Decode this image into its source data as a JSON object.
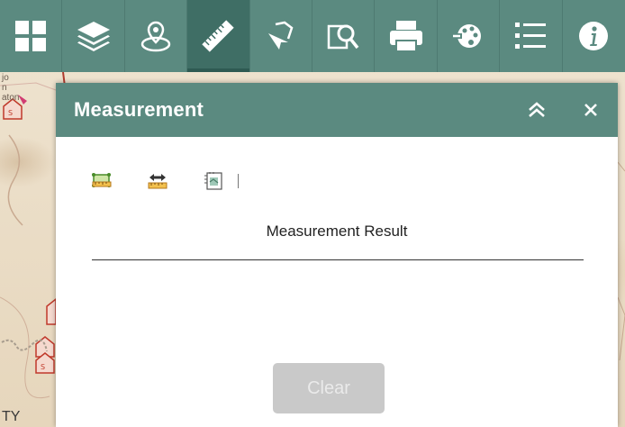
{
  "toolbar": {
    "buttons": [
      {
        "icon": "basemap-gallery-icon"
      },
      {
        "icon": "layers-icon"
      },
      {
        "icon": "location-icon"
      },
      {
        "icon": "ruler-icon",
        "active": true
      },
      {
        "icon": "select-icon"
      },
      {
        "icon": "query-icon"
      },
      {
        "icon": "print-icon"
      },
      {
        "icon": "palette-icon"
      },
      {
        "icon": "legend-icon"
      },
      {
        "icon": "info-icon"
      }
    ]
  },
  "panel": {
    "title": "Measurement",
    "collapse_icon": "double-chevron-up-icon",
    "close_icon": "close-icon",
    "tools": [
      "area-measure-icon",
      "distance-measure-icon",
      "location-measure-icon"
    ],
    "result_label": "Measurement Result",
    "clear_label": "Clear"
  },
  "map_labels": {
    "left_top": "jo",
    "left_second": "n",
    "left_third": "aton",
    "bottom_left": "TY"
  },
  "colors": {
    "accent": "#5b8a80",
    "accent_active": "#3f6e65",
    "clear_bg": "#c9c9c9"
  }
}
